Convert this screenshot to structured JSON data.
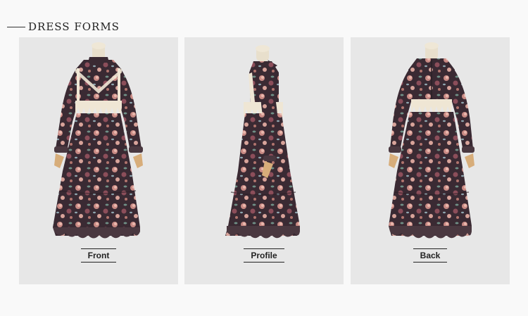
{
  "section": {
    "title": "DRESS FORMS"
  },
  "panels": [
    {
      "caption": "Front"
    },
    {
      "caption": "Profile"
    },
    {
      "caption": "Back"
    }
  ],
  "colors": {
    "page_background": "#f9f9f9",
    "panel_background": "#e7e7e7",
    "dress_base": "#3a2a33",
    "lace": "#efe6d4",
    "mannequin": "#e8dfcc",
    "hands": "#d7ad7a"
  }
}
